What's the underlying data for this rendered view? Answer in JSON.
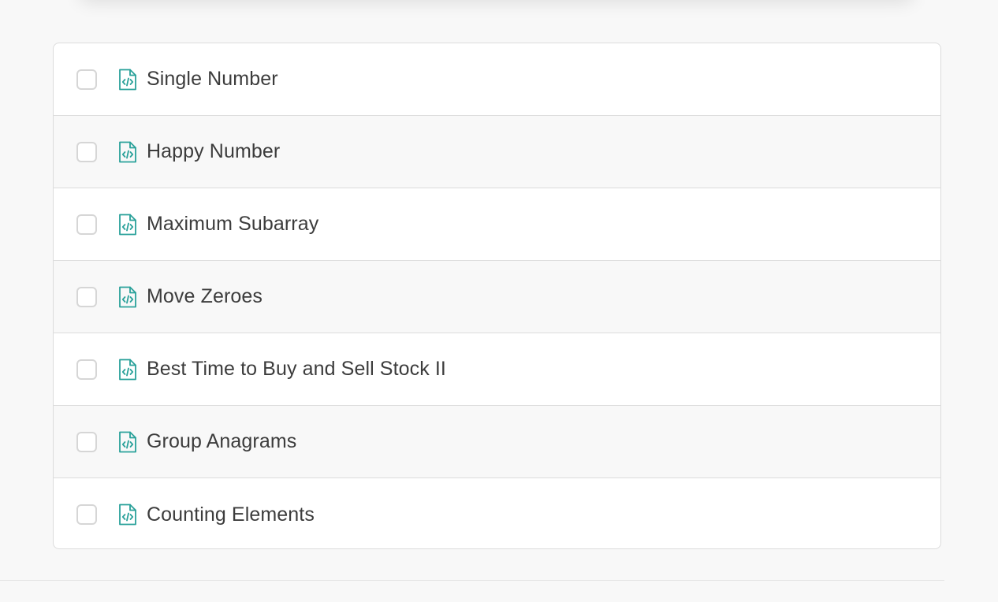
{
  "colors": {
    "icon": "#2aa19a",
    "text": "#3c3c3c",
    "border": "#dcdcdc",
    "background": "#f8f8f8"
  },
  "icons": {
    "file": "code-file-icon",
    "checkbox": "checkbox"
  },
  "problems": [
    {
      "title": "Single Number",
      "checked": false
    },
    {
      "title": "Happy Number",
      "checked": false
    },
    {
      "title": "Maximum Subarray",
      "checked": false
    },
    {
      "title": "Move Zeroes",
      "checked": false
    },
    {
      "title": "Best Time to Buy and Sell Stock II",
      "checked": false
    },
    {
      "title": "Group Anagrams",
      "checked": false
    },
    {
      "title": "Counting Elements",
      "checked": false
    }
  ]
}
